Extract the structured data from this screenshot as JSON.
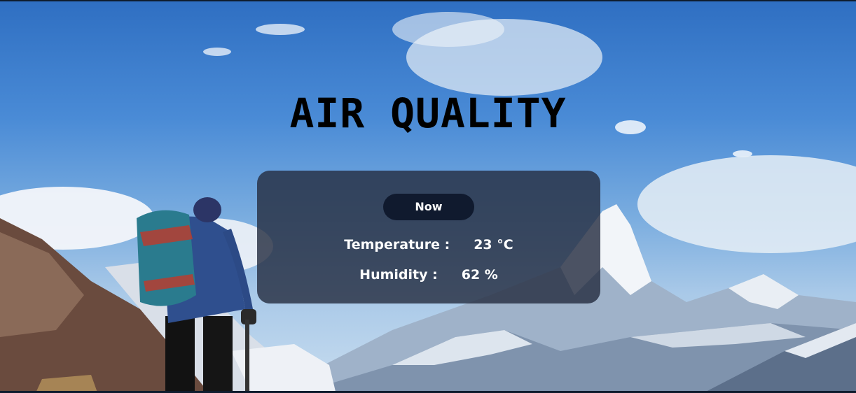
{
  "page": {
    "title": "AIR QUALITY"
  },
  "card": {
    "now_label": "Now",
    "temperature_label": "Temperature :",
    "temperature_value": "23 °C",
    "humidity_label": "Humidity :",
    "humidity_value": "62 %"
  },
  "background": {
    "scene": "hiker-mountain-photo"
  }
}
